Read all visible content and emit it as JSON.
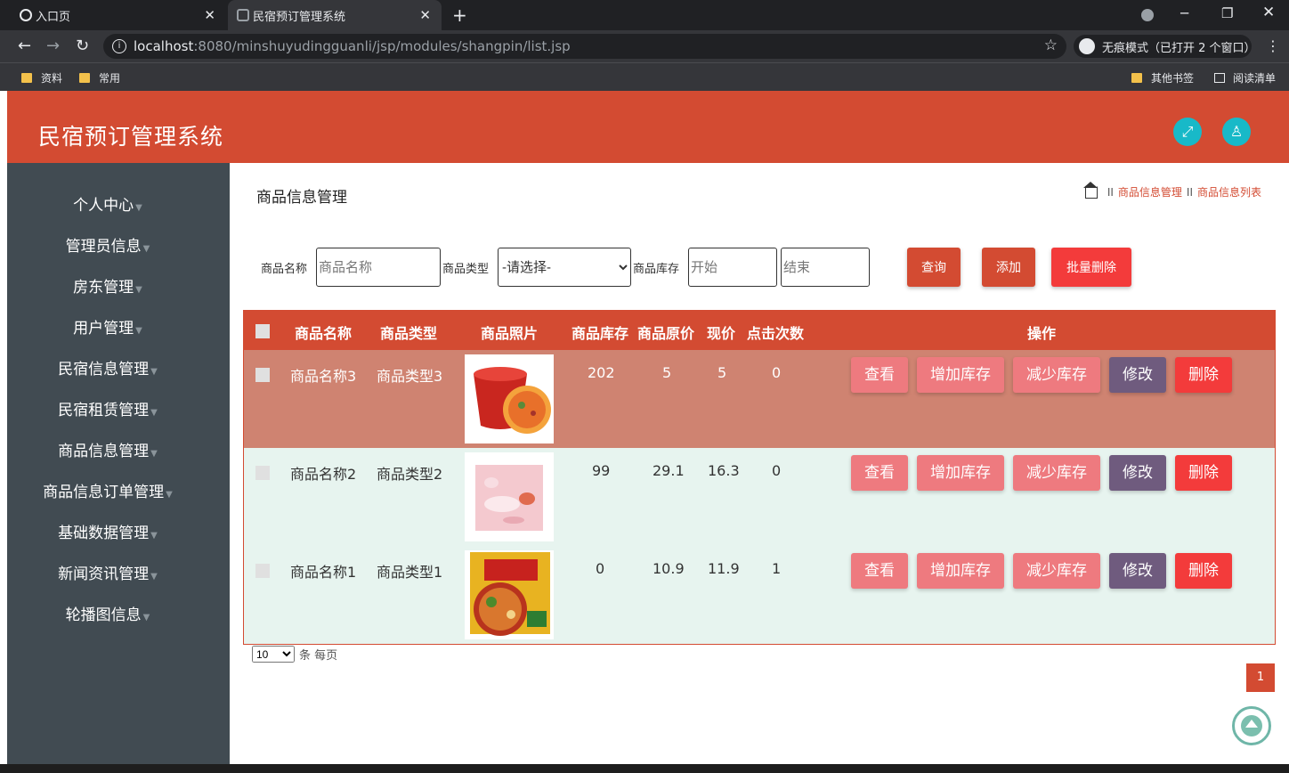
{
  "browser": {
    "tabs": [
      {
        "title": "入口页"
      },
      {
        "title": "民宿预订管理系统"
      }
    ],
    "url_host": "localhost",
    "url_path": ":8080/minshuyudingguanli/jsp/modules/shangpin/list.jsp",
    "incognito_label": "无痕模式（已打开 2 个窗口）",
    "bookmarks": [
      "资料",
      "常用"
    ],
    "bookmarks_right": [
      "其他书签",
      "阅读清单"
    ]
  },
  "app": {
    "title": "民宿预订管理系统",
    "accent_color": "#d34b32"
  },
  "sidebar": {
    "items": [
      {
        "label": "个人中心"
      },
      {
        "label": "管理员信息"
      },
      {
        "label": "房东管理"
      },
      {
        "label": "用户管理"
      },
      {
        "label": "民宿信息管理"
      },
      {
        "label": "民宿租赁管理"
      },
      {
        "label": "商品信息管理"
      },
      {
        "label": "商品信息订单管理"
      },
      {
        "label": "基础数据管理"
      },
      {
        "label": "新闻资讯管理"
      },
      {
        "label": "轮播图信息"
      }
    ]
  },
  "page": {
    "title": "商品信息管理",
    "breadcrumb": [
      "商品信息管理",
      "商品信息列表"
    ]
  },
  "filters": {
    "name_label": "商品名称",
    "name_placeholder": "商品名称",
    "type_label": "商品类型",
    "type_selected": "-请选择-",
    "stock_label": "商品库存",
    "stock_start_placeholder": "开始",
    "stock_end_placeholder": "结束",
    "query_btn": "查询",
    "add_btn": "添加",
    "batch_delete_btn": "批量删除"
  },
  "table": {
    "headers": [
      "商品名称",
      "商品类型",
      "商品照片",
      "商品库存",
      "商品原价",
      "现价",
      "点击次数",
      "操作"
    ],
    "actions": {
      "view": "查看",
      "add_stock": "增加库存",
      "reduce_stock": "减少库存",
      "edit": "修改",
      "delete": "删除"
    },
    "rows": [
      {
        "name": "商品名称3",
        "type": "商品类型3",
        "photo": "bowl-noodles",
        "stock": "202",
        "price": "5",
        "current": "5",
        "clicks": "0"
      },
      {
        "name": "商品名称2",
        "type": "商品类型2",
        "photo": "pink-dessert",
        "stock": "99",
        "price": "29.1",
        "current": "16.3",
        "clicks": "0"
      },
      {
        "name": "商品名称1",
        "type": "商品类型1",
        "photo": "rice-noodle-pack",
        "stock": "0",
        "price": "10.9",
        "current": "11.9",
        "clicks": "1"
      }
    ]
  },
  "pagination": {
    "page_size": "10",
    "page_size_suffix": "条 每页",
    "current_page": "1"
  }
}
